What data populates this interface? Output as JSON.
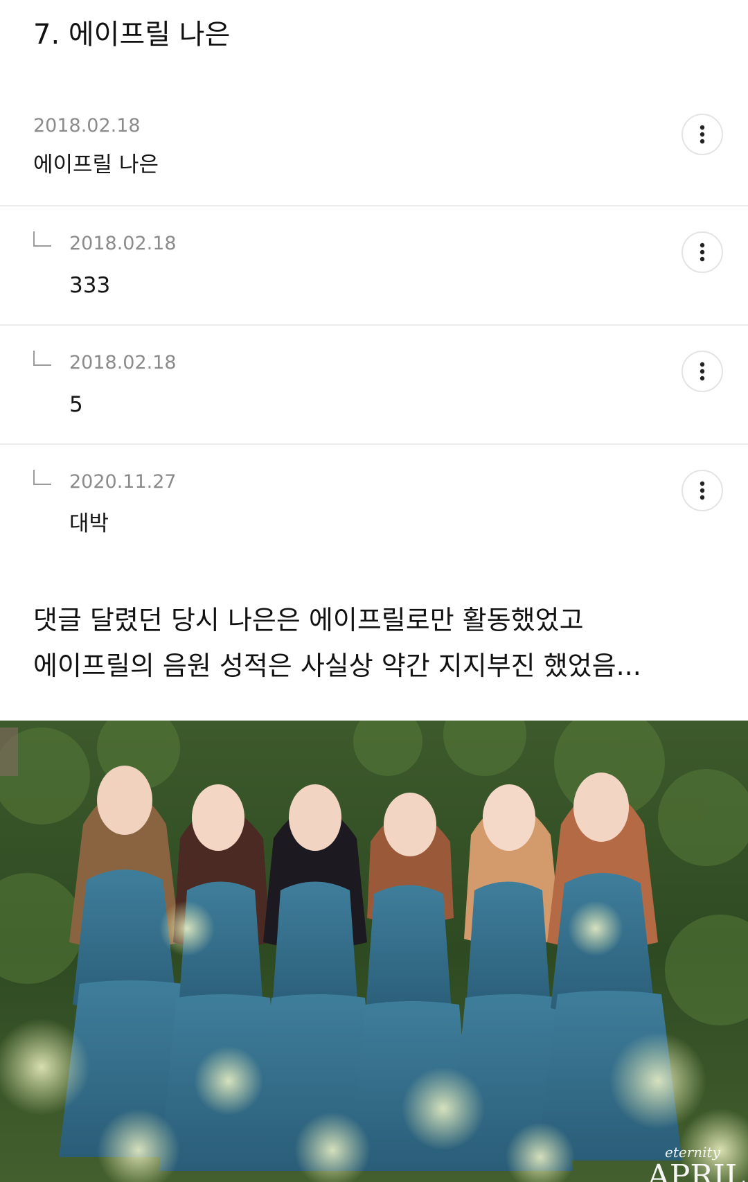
{
  "title": "7. 에이프릴 나은",
  "comments": [
    {
      "date": "2018.02.18",
      "text": "에이프릴 나은"
    },
    {
      "date": "2018.02.18",
      "text": "333"
    },
    {
      "date": "2018.02.18",
      "text": "5"
    },
    {
      "date": "2020.11.27",
      "text": "대박"
    }
  ],
  "body": {
    "line1": "댓글 달렸던 당시 나은은 에이프릴로만 활동했었고",
    "line2": "에이프릴의 음원 성적은 사실상 약간 지지부진 했었음..."
  },
  "photo": {
    "caption_small": "eternity",
    "caption_brand": "APRIL"
  },
  "icons": {
    "more": "more-vertical-icon",
    "reply": "reply-arrow-icon"
  },
  "colors": {
    "divider": "#ececec",
    "date": "#8b8b8b",
    "dress": "#2f6a86"
  }
}
